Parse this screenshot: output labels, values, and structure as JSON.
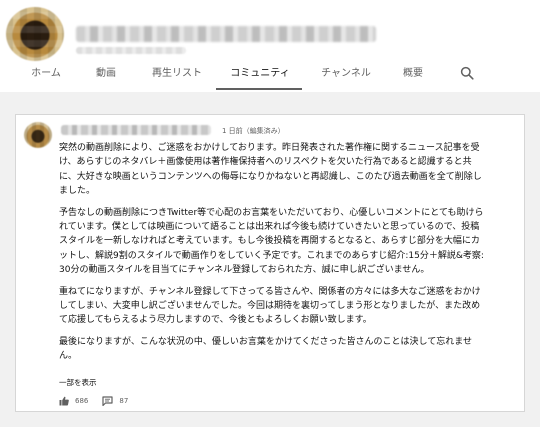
{
  "tabs": {
    "home": "ホーム",
    "videos": "動画",
    "playlists": "再生リスト",
    "community": "コミュニティ",
    "channels": "チャンネル",
    "about": "概要"
  },
  "active_tab": "community",
  "icons": {
    "search": "search-icon",
    "like": "thumb-up-icon",
    "comment": "comment-icon"
  },
  "post": {
    "timestamp": "1 日前（編集済み）",
    "paragraphs": [
      "突然の動画削除により、ご迷惑をおかけしております。昨日発表された著作権に関するニュース記事を受け、あらすじのネタバレ＋画像使用は著作権保持者へのリスペクトを欠いた行為であると認識すると共に、大好きな映画というコンテンツへの侮辱になりかねないと再認識し、このたび過去動画を全て削除しました。",
      "予告なしの動画削除につきTwitter等で心配のお言葉をいただいており、心優しいコメントにとても助けられています。僕としては映画について語ることは出来れば今後も続けていきたいと思っているので、投稿スタイルを一新しなければと考えています。もし今後投稿を再開するとなると、あらすじ部分を大幅にカットし、解説9割のスタイルで動画作りをしていく予定です。これまでのあらすじ紹介:15分＋解説&考察:30分の動画スタイルを目当てにチャンネル登録しておられた方、誠に申し訳ございません。",
      "重ねてになりますが、チャンネル登録して下さってる皆さんや、関係者の方々には多大なご迷惑をおかけしてしまい、大変申し訳ございませんでした。今回は期待を裏切ってしまう形となりましたが、また改めて応援してもらえるよう尽力しますので、今後ともよろしくお願い致します。",
      "最後になりますが、こんな状況の中、優しいお言葉をかけてくださった皆さんのことは決して忘れません。"
    ],
    "show_more": "一部を表示",
    "likes": "686",
    "comments": "87"
  }
}
